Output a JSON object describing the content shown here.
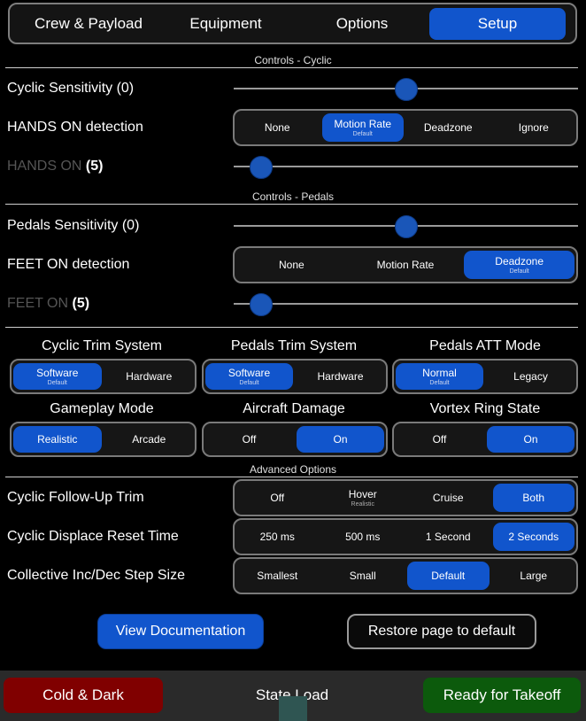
{
  "tabs": [
    {
      "label": "Crew & Payload",
      "active": false
    },
    {
      "label": "Equipment",
      "active": false
    },
    {
      "label": "Options",
      "active": false
    },
    {
      "label": "Setup",
      "active": true
    }
  ],
  "sections": {
    "cyclic": "Controls - Cyclic",
    "pedals": "Controls - Pedals",
    "advanced": "Advanced Options"
  },
  "cyclic": {
    "sensitivity_label": "Cyclic Sensitivity (0)",
    "sensitivity_level": 0.5,
    "hands_on_detection_label": "HANDS ON detection",
    "hands_on_detection_options": [
      {
        "label": "None",
        "sub": ""
      },
      {
        "label": "Motion Rate",
        "sub": "Default"
      },
      {
        "label": "Deadzone",
        "sub": ""
      },
      {
        "label": "Ignore",
        "sub": ""
      }
    ],
    "hands_on_detection_selected": "Motion Rate",
    "hands_on_label": "HANDS ON",
    "hands_on_value": "(5)",
    "hands_on_level": 0.05
  },
  "pedals": {
    "sensitivity_label": "Pedals Sensitivity (0)",
    "sensitivity_level": 0.5,
    "feet_on_detection_label": "FEET ON detection",
    "feet_on_detection_options": [
      {
        "label": "None",
        "sub": ""
      },
      {
        "label": "Motion Rate",
        "sub": ""
      },
      {
        "label": "Deadzone",
        "sub": "Default"
      }
    ],
    "feet_on_detection_selected": "Deadzone",
    "feet_on_label": "FEET ON",
    "feet_on_value": "(5)",
    "feet_on_level": 0.05
  },
  "toggles": [
    {
      "title": "Cyclic Trim System",
      "options": [
        {
          "label": "Software",
          "sub": "Default"
        },
        {
          "label": "Hardware",
          "sub": ""
        }
      ],
      "selected": "Software"
    },
    {
      "title": "Pedals Trim System",
      "options": [
        {
          "label": "Software",
          "sub": "Default"
        },
        {
          "label": "Hardware",
          "sub": ""
        }
      ],
      "selected": "Software"
    },
    {
      "title": "Pedals ATT Mode",
      "options": [
        {
          "label": "Normal",
          "sub": "Default"
        },
        {
          "label": "Legacy",
          "sub": ""
        }
      ],
      "selected": "Normal"
    },
    {
      "title": "Gameplay Mode",
      "options": [
        {
          "label": "Realistic",
          "sub": ""
        },
        {
          "label": "Arcade",
          "sub": ""
        }
      ],
      "selected": "Realistic"
    },
    {
      "title": "Aircraft Damage",
      "options": [
        {
          "label": "Off",
          "sub": ""
        },
        {
          "label": "On",
          "sub": ""
        }
      ],
      "selected": "On"
    },
    {
      "title": "Vortex Ring State",
      "options": [
        {
          "label": "Off",
          "sub": ""
        },
        {
          "label": "On",
          "sub": ""
        }
      ],
      "selected": "On"
    }
  ],
  "advanced": [
    {
      "label": "Cyclic Follow-Up Trim",
      "options": [
        {
          "label": "Off",
          "sub": ""
        },
        {
          "label": "Hover",
          "sub": "Realistic"
        },
        {
          "label": "Cruise",
          "sub": ""
        },
        {
          "label": "Both",
          "sub": ""
        }
      ],
      "selected": "Both"
    },
    {
      "label": "Cyclic Displace Reset Time",
      "options": [
        {
          "label": "250 ms",
          "sub": ""
        },
        {
          "label": "500 ms",
          "sub": ""
        },
        {
          "label": "1 Second",
          "sub": ""
        },
        {
          "label": "2 Seconds",
          "sub": ""
        }
      ],
      "selected": "2 Seconds"
    },
    {
      "label": "Collective Inc/Dec Step Size",
      "options": [
        {
          "label": "Smallest",
          "sub": ""
        },
        {
          "label": "Small",
          "sub": ""
        },
        {
          "label": "Default",
          "sub": ""
        },
        {
          "label": "Large",
          "sub": ""
        }
      ],
      "selected": "Default"
    }
  ],
  "actions": {
    "view_documentation": "View Documentation",
    "restore_default": "Restore page to default"
  },
  "bottom_bar": {
    "cold_dark": "Cold & Dark",
    "state_load": "State Load",
    "ready": "Ready for Takeoff"
  },
  "colors": {
    "accent": "#1155cc",
    "cold_dark": "#800000",
    "ready": "#0c5a0c"
  }
}
